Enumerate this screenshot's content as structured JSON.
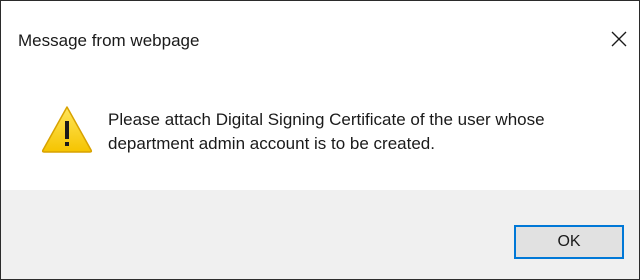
{
  "dialog": {
    "title": "Message from webpage",
    "close_icon": "close-icon",
    "message": "Please attach Digital Signing Certificate of the user whose department admin account is to be created.",
    "icon": "warning-icon",
    "ok_label": "OK"
  },
  "colors": {
    "warning_fill": "#fcd116",
    "warning_outline": "#d8a200",
    "footer_bg": "#f0f0f0",
    "button_border": "#0078d7",
    "button_bg": "#e1e1e1"
  }
}
